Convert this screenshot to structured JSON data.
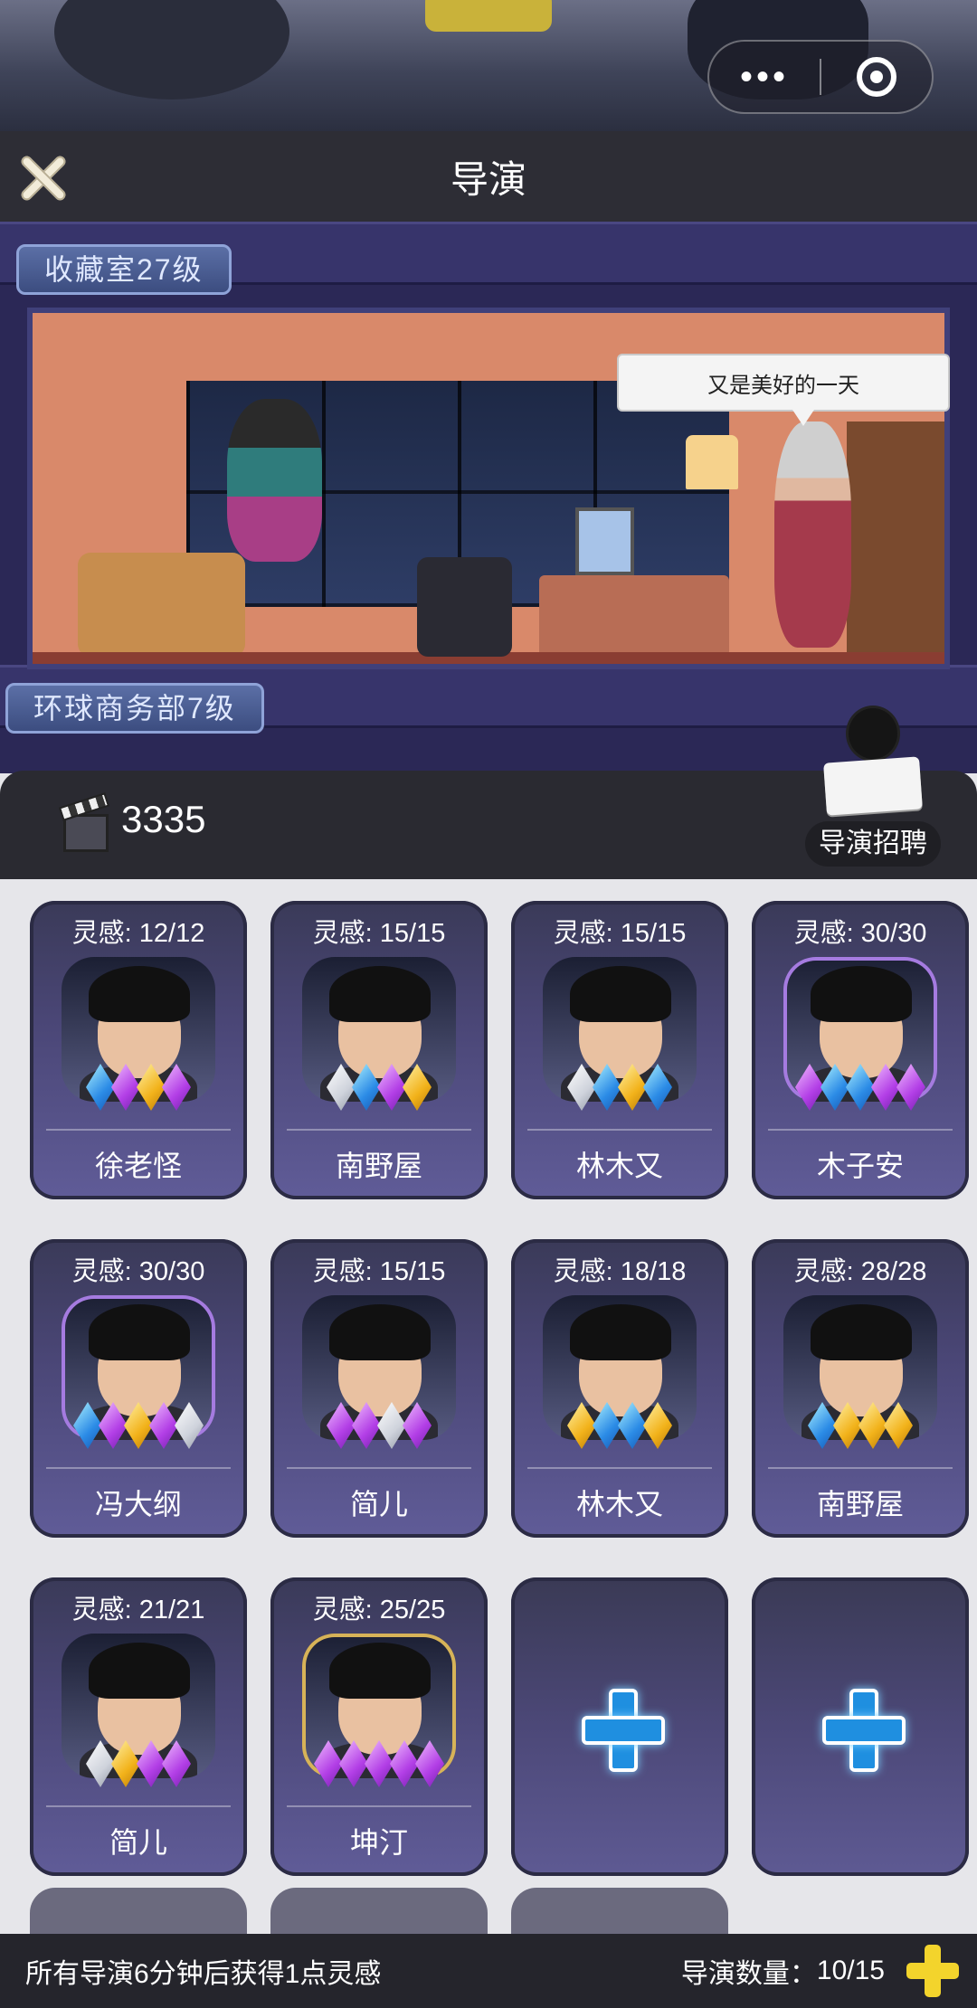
{
  "top_capsule": {
    "more_icon": "ellipsis-icon",
    "close_icon": "target-circle-icon"
  },
  "header": {
    "title": "导演",
    "close_icon": "close-x-icon"
  },
  "scene": {
    "floor_upper": "收藏室27级",
    "floor_lower": "环球商务部7级",
    "speech": "又是美好的一天"
  },
  "resource": {
    "icon": "clapperboard-icon",
    "value": "3335"
  },
  "recruit": {
    "label": "导演招聘",
    "icon": "recruiter-icon"
  },
  "directors": [
    {
      "inspiration": "灵感: 12/12",
      "name": "徐老怪",
      "frame": "plain",
      "gems": [
        "blue",
        "purple",
        "gold",
        "purple"
      ]
    },
    {
      "inspiration": "灵感: 15/15",
      "name": "南野屋",
      "frame": "plain",
      "gems": [
        "white",
        "blue",
        "purple",
        "gold"
      ]
    },
    {
      "inspiration": "灵感: 15/15",
      "name": "林木又",
      "frame": "plain",
      "gems": [
        "white",
        "blue",
        "gold",
        "blue"
      ]
    },
    {
      "inspiration": "灵感: 30/30",
      "name": "木子安",
      "frame": "purple",
      "gems": [
        "purple",
        "blue",
        "blue",
        "purple",
        "purple"
      ]
    },
    {
      "inspiration": "灵感: 30/30",
      "name": "冯大纲",
      "frame": "purple",
      "gems": [
        "blue",
        "purple",
        "gold",
        "purple",
        "white"
      ]
    },
    {
      "inspiration": "灵感: 15/15",
      "name": "简儿",
      "frame": "plain",
      "gems": [
        "purple",
        "purple",
        "white",
        "purple"
      ]
    },
    {
      "inspiration": "灵感: 18/18",
      "name": "林木又",
      "frame": "plain",
      "gems": [
        "gold",
        "blue",
        "blue",
        "gold"
      ]
    },
    {
      "inspiration": "灵感: 28/28",
      "name": "南野屋",
      "frame": "plain",
      "gems": [
        "blue",
        "gold",
        "gold",
        "gold"
      ]
    },
    {
      "inspiration": "灵感: 21/21",
      "name": "简儿",
      "frame": "plain",
      "gems": [
        "white",
        "gold",
        "purple",
        "purple"
      ]
    },
    {
      "inspiration": "灵感: 25/25",
      "name": "坤汀",
      "frame": "gold",
      "gems": [
        "purple",
        "purple",
        "purple",
        "purple",
        "purple"
      ]
    }
  ],
  "empty_slots": {
    "count": 2,
    "icon": "plus-icon"
  },
  "footer": {
    "note": "所有导演6分钟后获得1点灵感",
    "count_label": "导演数量：",
    "count_value": "10/15",
    "add_icon": "plus-icon"
  },
  "colors": {
    "card_top": "#3a3a58",
    "card_bottom": "#605c98",
    "footer_bg": "#25252c",
    "accent_plus": "#f3d42c"
  }
}
